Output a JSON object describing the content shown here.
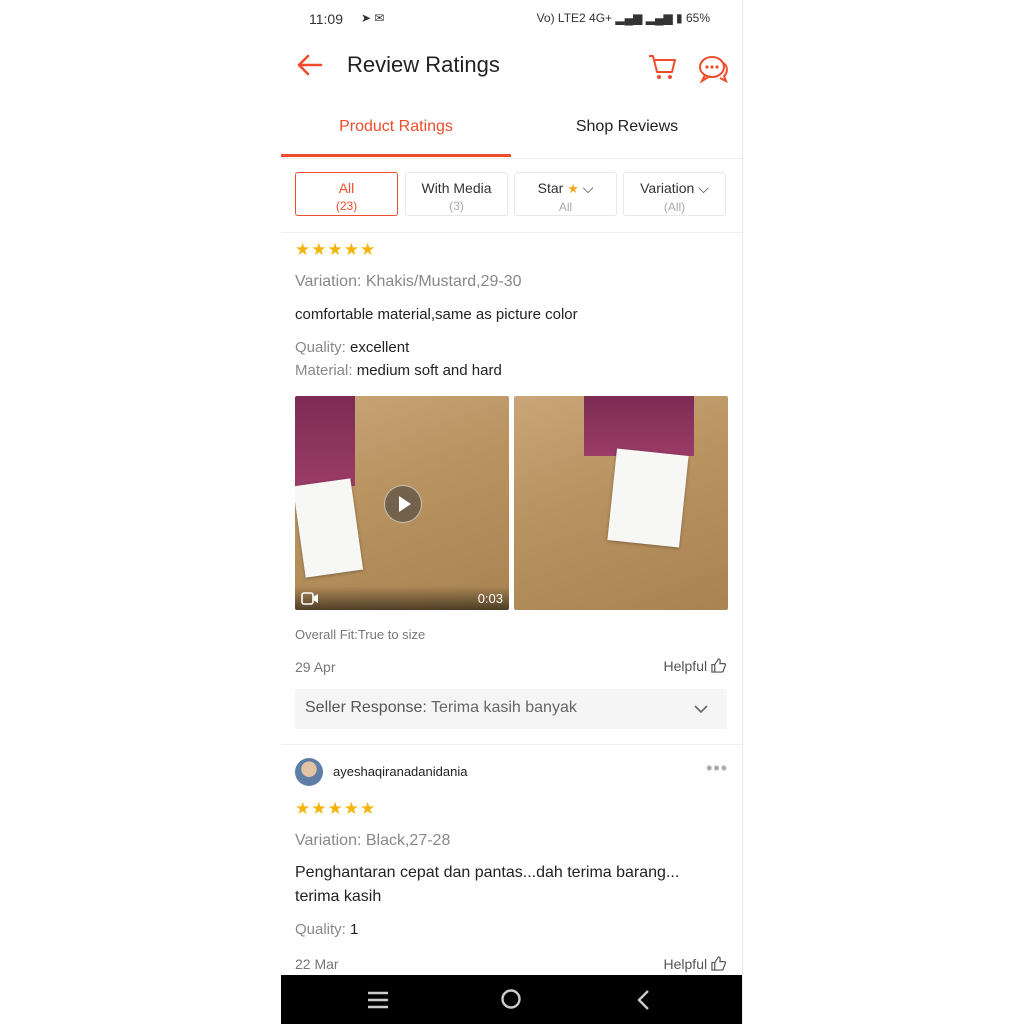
{
  "status_bar": {
    "time": "11:09",
    "network": "Vo) LTE2 4G+",
    "battery": "65%"
  },
  "header": {
    "title": "Review Ratings"
  },
  "tabs": [
    {
      "label": "Product Ratings",
      "active": true
    },
    {
      "label": "Shop Reviews",
      "active": false
    }
  ],
  "filters": [
    {
      "label": "All",
      "sub": "(23)",
      "active": true
    },
    {
      "label": "With Media",
      "sub": "(3)",
      "active": false
    },
    {
      "label": "Star",
      "sub": "All",
      "active": false
    },
    {
      "label": "Variation",
      "sub": "(All)",
      "active": false
    }
  ],
  "reviews": [
    {
      "rating": 5,
      "variation": "Variation: Khakis/Mustard,29-30",
      "comment": "comfortable material,same as picture color",
      "quality_label": "Quality:",
      "quality_value": "excellent",
      "material_label": "Material:",
      "material_value": "medium soft and hard",
      "video_duration": "0:03",
      "overall_fit": "Overall Fit:True to size",
      "date": "29 Apr",
      "helpful": "Helpful",
      "seller_label": "Seller Response:",
      "seller_text": "Terima kasih banyak"
    },
    {
      "username": "ayeshaqiranadanidania",
      "rating": 5,
      "variation": "Variation: Black,27-28",
      "comment_line1": "Penghantaran cepat dan pantas...dah terima barang...",
      "comment_line2": "terima kasih",
      "quality_label": "Quality:",
      "quality_value": "1",
      "date": "22 Mar",
      "helpful": "Helpful"
    }
  ],
  "colors": {
    "accent": "#ee4d2d",
    "star": "#f5b40b"
  }
}
